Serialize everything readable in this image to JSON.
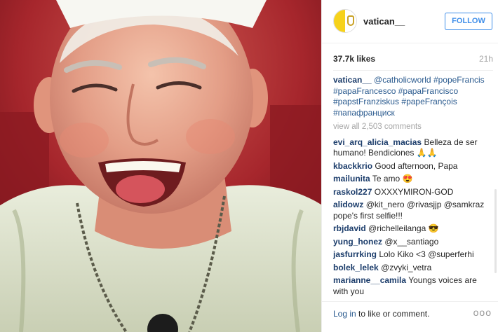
{
  "post": {
    "username": "vatican__",
    "follow_label": "FOLLOW",
    "likes": "37.7k likes",
    "time": "21h",
    "caption_user": "vatican__",
    "caption_tags": [
      "@catholicworld",
      "#popeFrancis",
      "#papaFrancesco",
      "#papaFrancisco",
      "#papstFranziskus",
      "#papeFrançois",
      "#папафранциск"
    ],
    "view_all": "view all 2,503 comments"
  },
  "comments": [
    {
      "user": "evi_arq_alicia_macias",
      "text": "Belleza de ser humano! Bendiciones 🙏🙏"
    },
    {
      "user": "kbackkrio",
      "text": "Good afternoon, Papa"
    },
    {
      "user": "mailunita",
      "text": "Te amo 😍"
    },
    {
      "user": "raskol227",
      "text": "OXXXYMIRON-GOD"
    },
    {
      "user": "alidowz",
      "text": "@kit_nero @rivasjjp @samkraz pope's first selfie!!!"
    },
    {
      "user": "rbjdavid",
      "text": "@richelleilanga 😎"
    },
    {
      "user": "yung_honez",
      "text": "@x__santiago"
    },
    {
      "user": "jasfurrking",
      "text": "Lolo Kiko <3 @superferhi"
    },
    {
      "user": "bolek_lelek",
      "text": "@zvyki_vetra"
    },
    {
      "user": "marianne__camila",
      "text": "Youngs voices are with you"
    }
  ],
  "footer": {
    "login_link": "Log in",
    "login_rest": " to like or comment.",
    "more_icon": "ellipsis-icon",
    "more_glyph": "ooo"
  },
  "colors": {
    "accent": "#3f8ee9",
    "username": "#1c3d6b",
    "hashtag": "#2b5b8f",
    "muted": "#a5a5a5",
    "photo_bg": "#a4242a"
  }
}
